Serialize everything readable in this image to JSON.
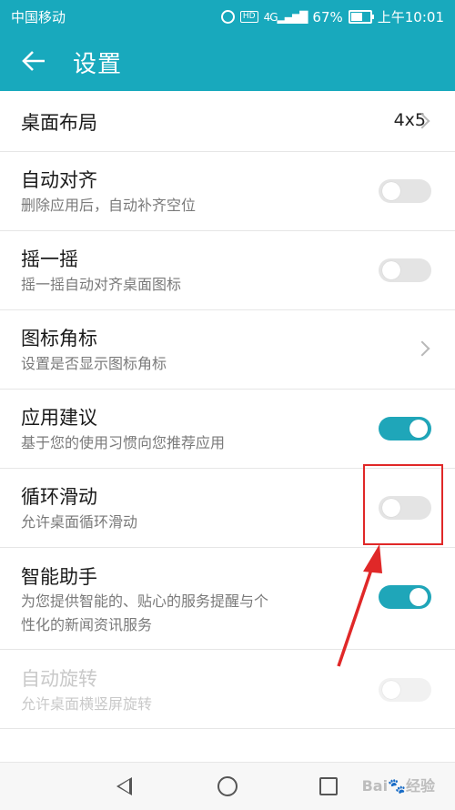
{
  "status_bar": {
    "carrier": "中国移动",
    "hd": "HD",
    "network": "4G",
    "battery_pct_text": "67%",
    "battery_level": 0.67,
    "time": "上午10:01"
  },
  "app_bar": {
    "title": "设置"
  },
  "settings": {
    "desktop_layout": {
      "title": "桌面布局",
      "value": "4x5"
    },
    "auto_align": {
      "title": "自动对齐",
      "subtitle": "删除应用后，自动补齐空位",
      "enabled": false
    },
    "shake": {
      "title": "摇一摇",
      "subtitle": "摇一摇自动对齐桌面图标",
      "enabled": false
    },
    "icon_badge": {
      "title": "图标角标",
      "subtitle": "设置是否显示图标角标"
    },
    "app_suggest": {
      "title": "应用建议",
      "subtitle": "基于您的使用习惯向您推荐应用",
      "enabled": true
    },
    "loop_scroll": {
      "title": "循环滑动",
      "subtitle": "允许桌面循环滑动",
      "enabled": false
    },
    "smart_assistant": {
      "title": "智能助手",
      "subtitle": "为您提供智能的、贴心的服务提醒与个性化的新闻资讯服务",
      "subtitle_line1": "为您提供智能的、贴心的服务提醒与个",
      "subtitle_line2": "性化的新闻资讯服务",
      "enabled": true
    },
    "auto_rotate": {
      "title": "自动旋转",
      "subtitle": "允许桌面横竖屏旋转",
      "enabled": false,
      "disabled": true
    }
  },
  "colors": {
    "accent": "#18a9bd",
    "toggle_on": "#1fa6b9",
    "annotation": "#e02828"
  },
  "watermark": "Bai🐾经验"
}
